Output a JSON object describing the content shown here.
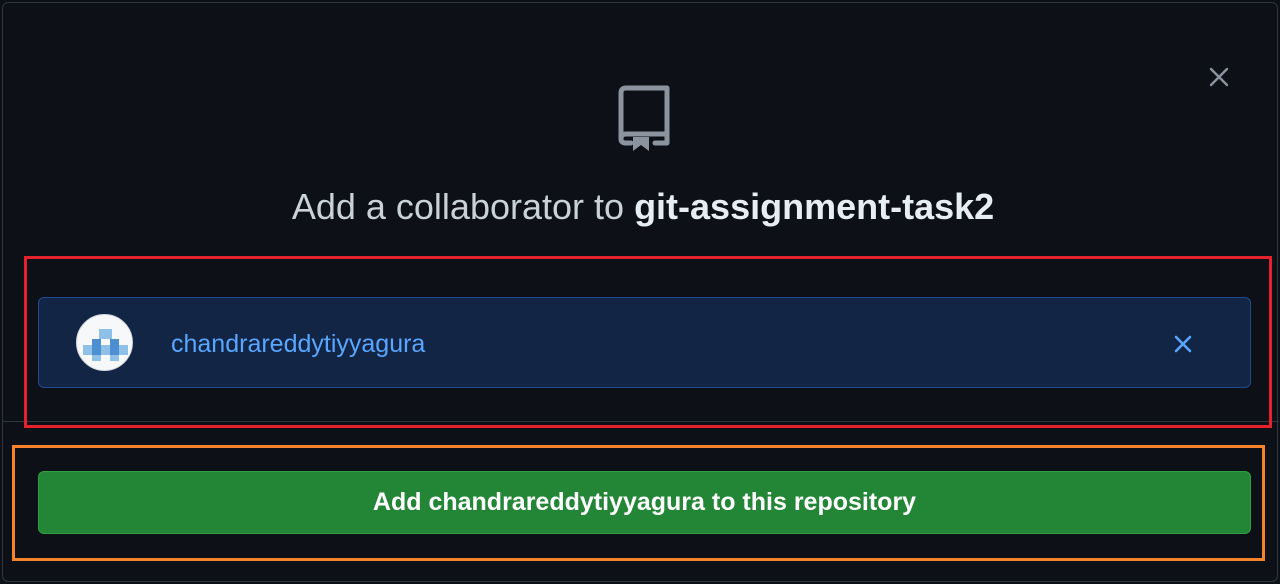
{
  "dialog": {
    "title_prefix": "Add a collaborator to",
    "repo_name": "git-assignment-task2",
    "icons": {
      "close": "close-icon",
      "repo": "repo-icon"
    }
  },
  "selected_user": {
    "username": "chandrareddytiyyagura",
    "avatar": "identicon-avatar",
    "remove_icon": "remove-icon"
  },
  "action": {
    "add_button_label": "Add chandrareddytiyyagura to this repository"
  },
  "colors": {
    "background": "#0d1117",
    "selected_bg": "#132544",
    "username": "#58a6ff",
    "button_green": "#238636",
    "annotation_red": "#e5212b",
    "annotation_orange": "#f5832b"
  }
}
